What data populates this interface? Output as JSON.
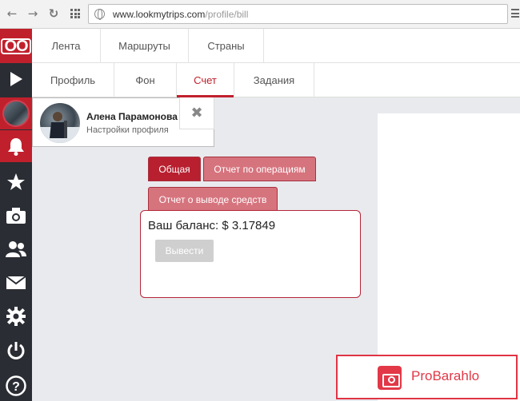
{
  "browser": {
    "url_host": "www.lookmytrips.com",
    "url_path": "/profile/bill",
    "icons": [
      "back-icon",
      "forward-icon",
      "reload-icon",
      "apps-icon",
      "globe-icon",
      "menu-icon"
    ]
  },
  "sidebar": {
    "logo": "OO",
    "items": [
      {
        "name": "play-icon",
        "glyph": "▶"
      },
      {
        "name": "avatar",
        "glyph": ""
      },
      {
        "name": "bell-icon",
        "glyph": "🔔"
      },
      {
        "name": "star-icon",
        "glyph": "★"
      },
      {
        "name": "camera-icon",
        "glyph": "📷"
      },
      {
        "name": "users-icon",
        "glyph": "👥"
      },
      {
        "name": "mail-icon",
        "glyph": "✉"
      },
      {
        "name": "gear-icon",
        "glyph": "⚙"
      },
      {
        "name": "power-icon",
        "glyph": "⏻"
      },
      {
        "name": "help-icon",
        "glyph": "?"
      }
    ]
  },
  "topnav": {
    "tabs": [
      "Лента",
      "Маршруты",
      "Страны"
    ]
  },
  "subnav": {
    "tabs": [
      "Профиль",
      "Фон",
      "Счет",
      "Задания"
    ],
    "active": "Счет"
  },
  "profile_card": {
    "name": "Алена Парамонова",
    "subtitle": "Настройки профиля",
    "close_glyph": "✖"
  },
  "bill": {
    "tabs": [
      "Общая",
      "Отчет по операциям",
      "Отчет о выводе средств"
    ],
    "active_tab": "Общая",
    "balance_text": "Ваш баланс: $ 3.17849",
    "withdraw_label": "Вывести"
  },
  "watermark": {
    "text": "ProBarahlo"
  },
  "colors": {
    "accent": "#c0202c",
    "sidebar": "#2a2d34",
    "tab_inactive": "#d6747e"
  }
}
